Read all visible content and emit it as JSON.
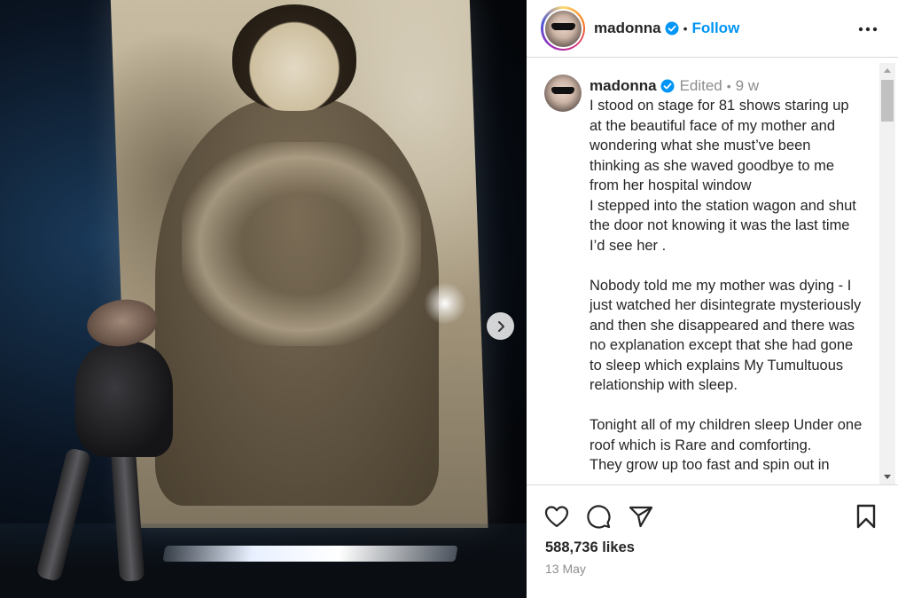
{
  "post": {
    "username": "madonna",
    "follow_label": "Follow",
    "separator": "•"
  },
  "caption": {
    "username": "madonna",
    "edited": "Edited",
    "separator": "•",
    "time": "9 w",
    "text": "I stood on stage for 81 shows staring up at the beautiful face of my mother and wondering what she must’ve been thinking as she waved goodbye to me from her hospital window\nI stepped into the station wagon and shut the door not knowing it was the last time I’d see her .\n\nNobody told me my mother was dying - I just watched her disintegrate mysteriously and then she disappeared and there was no explanation except that she had gone to sleep which explains My Tumultuous relationship with sleep.\n\nTonight all of my children sleep Under one roof which is Rare and comforting.\nThey grow up too fast and spin out in"
  },
  "engagement": {
    "likes": "588,736 likes",
    "date": "13 May"
  },
  "icons": {
    "next": "chevron-right-icon",
    "more": "more-horizontal-icon",
    "like": "heart-icon",
    "comment": "comment-icon",
    "share": "paper-plane-icon",
    "save": "bookmark-icon",
    "verified": "verified-badge-icon"
  },
  "colors": {
    "link_blue": "#0095f6",
    "verified_blue": "#0095f6",
    "text_primary": "#262626",
    "text_secondary": "#8e8e8e",
    "border": "#dbdbdb"
  }
}
